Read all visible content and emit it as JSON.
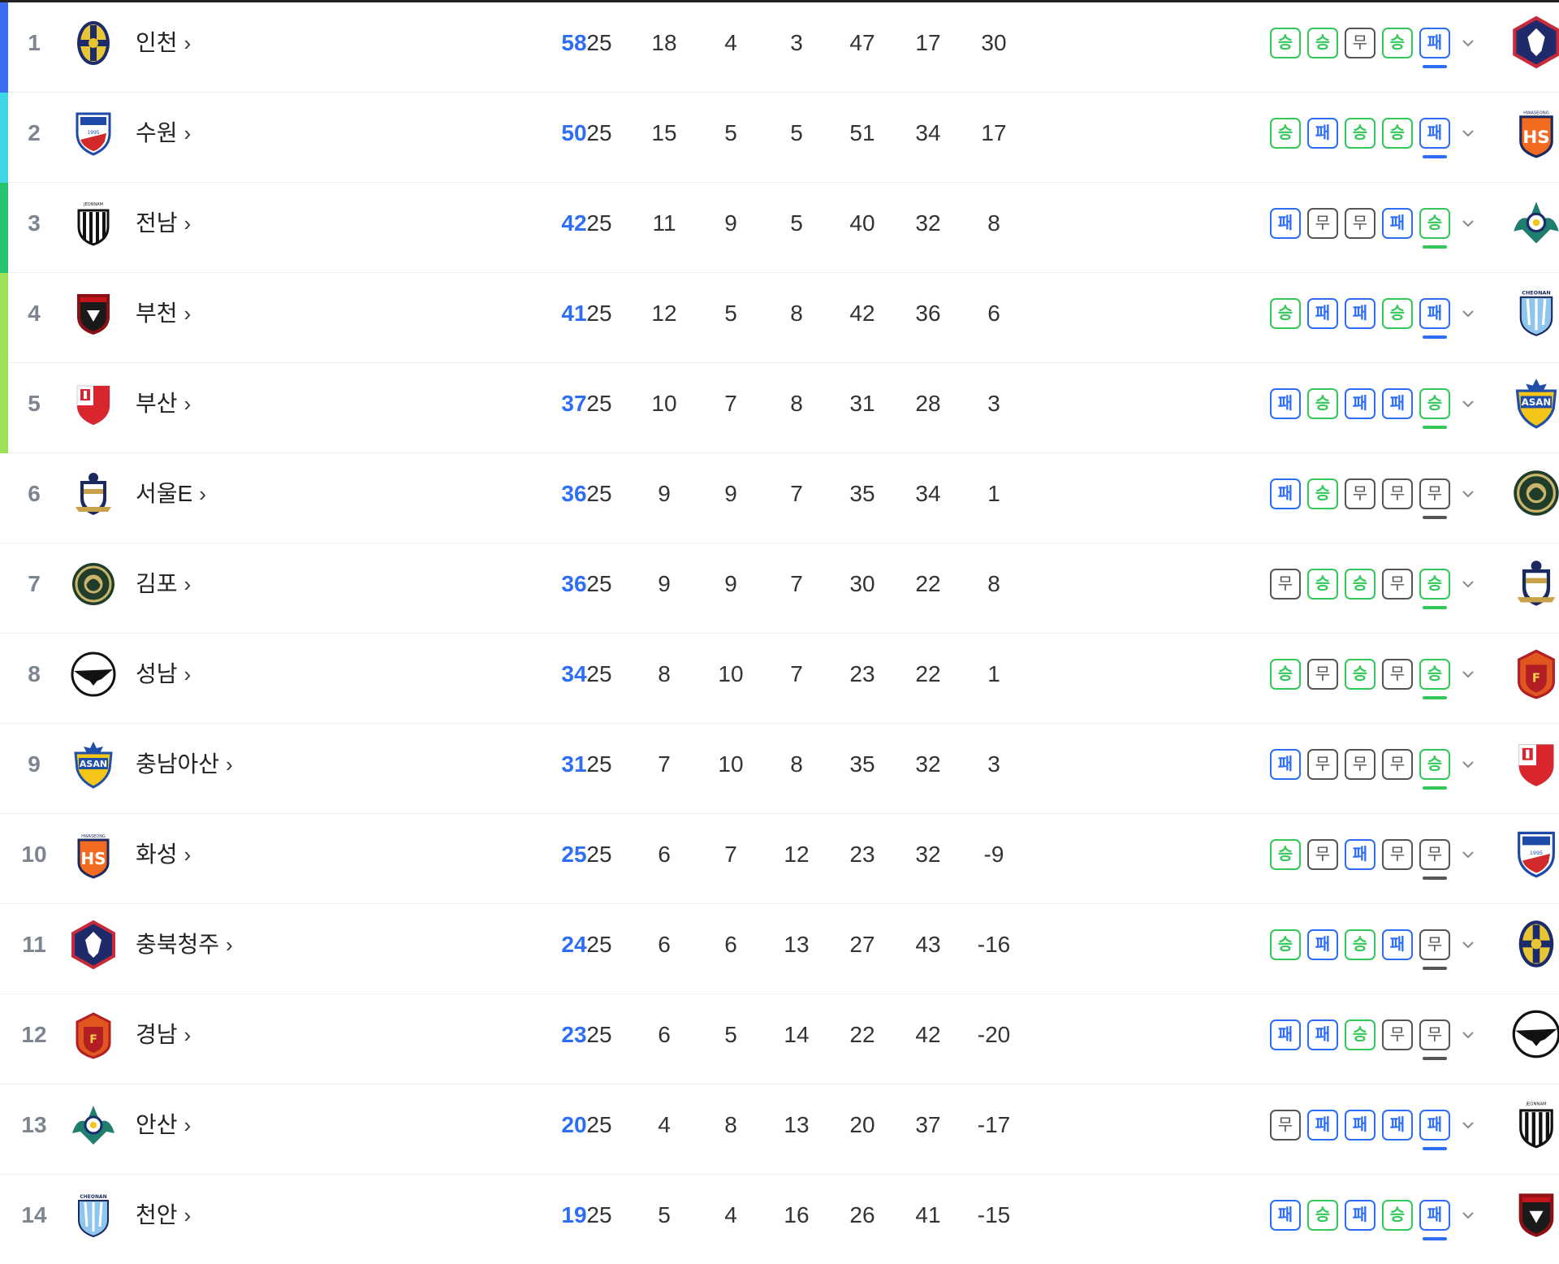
{
  "standings": [
    {
      "rank": "1",
      "team": "인천",
      "logo": "incheon-crest-icon",
      "band": "#3a6df0",
      "pts": "58",
      "mp": "25",
      "w": "18",
      "d": "4",
      "l": "3",
      "gf": "47",
      "ga": "17",
      "gd": "30",
      "form": [
        "승",
        "승",
        "무",
        "승",
        "패"
      ],
      "next_opponent": "chungbuk-cheongju-crest-icon"
    },
    {
      "rank": "2",
      "team": "수원",
      "logo": "suwon-crest-icon",
      "band": "#3fd6e6",
      "pts": "50",
      "mp": "25",
      "w": "15",
      "d": "5",
      "l": "5",
      "gf": "51",
      "ga": "34",
      "gd": "17",
      "form": [
        "승",
        "패",
        "승",
        "승",
        "패"
      ],
      "next_opponent": "hwaseong-crest-icon"
    },
    {
      "rank": "3",
      "team": "전남",
      "logo": "jeonnam-crest-icon",
      "band": "#26c270",
      "pts": "42",
      "mp": "25",
      "w": "11",
      "d": "9",
      "l": "5",
      "gf": "40",
      "ga": "32",
      "gd": "8",
      "form": [
        "패",
        "무",
        "무",
        "패",
        "승"
      ],
      "next_opponent": "ansan-crest-icon"
    },
    {
      "rank": "4",
      "team": "부천",
      "logo": "bucheon-crest-icon",
      "band": "#9ee05a",
      "pts": "41",
      "mp": "25",
      "w": "12",
      "d": "5",
      "l": "8",
      "gf": "42",
      "ga": "36",
      "gd": "6",
      "form": [
        "승",
        "패",
        "패",
        "승",
        "패"
      ],
      "next_opponent": "cheonan-crest-icon"
    },
    {
      "rank": "5",
      "team": "부산",
      "logo": "busan-crest-icon",
      "band": "#9ee05a",
      "pts": "37",
      "mp": "25",
      "w": "10",
      "d": "7",
      "l": "8",
      "gf": "31",
      "ga": "28",
      "gd": "3",
      "form": [
        "패",
        "승",
        "패",
        "패",
        "승"
      ],
      "next_opponent": "chungnam-asan-crest-icon"
    },
    {
      "rank": "6",
      "team": "서울E",
      "logo": "seoul-e-crest-icon",
      "band": "",
      "pts": "36",
      "mp": "25",
      "w": "9",
      "d": "9",
      "l": "7",
      "gf": "35",
      "ga": "34",
      "gd": "1",
      "form": [
        "패",
        "승",
        "무",
        "무",
        "무"
      ],
      "next_opponent": "gimpo-crest-icon"
    },
    {
      "rank": "7",
      "team": "김포",
      "logo": "gimpo-crest-icon",
      "band": "",
      "pts": "36",
      "mp": "25",
      "w": "9",
      "d": "9",
      "l": "7",
      "gf": "30",
      "ga": "22",
      "gd": "8",
      "form": [
        "무",
        "승",
        "승",
        "무",
        "승"
      ],
      "next_opponent": "seoul-e-crest-icon"
    },
    {
      "rank": "8",
      "team": "성남",
      "logo": "seongnam-crest-icon",
      "band": "",
      "pts": "34",
      "mp": "25",
      "w": "8",
      "d": "10",
      "l": "7",
      "gf": "23",
      "ga": "22",
      "gd": "1",
      "form": [
        "승",
        "무",
        "승",
        "무",
        "승"
      ],
      "next_opponent": "gyeongnam-crest-icon"
    },
    {
      "rank": "9",
      "team": "충남아산",
      "logo": "chungnam-asan-crest-icon",
      "band": "",
      "pts": "31",
      "mp": "25",
      "w": "7",
      "d": "10",
      "l": "8",
      "gf": "35",
      "ga": "32",
      "gd": "3",
      "form": [
        "패",
        "무",
        "무",
        "무",
        "승"
      ],
      "next_opponent": "busan-crest-icon"
    },
    {
      "rank": "10",
      "team": "화성",
      "logo": "hwaseong-crest-icon",
      "band": "",
      "pts": "25",
      "mp": "25",
      "w": "6",
      "d": "7",
      "l": "12",
      "gf": "23",
      "ga": "32",
      "gd": "-9",
      "form": [
        "승",
        "무",
        "패",
        "무",
        "무"
      ],
      "next_opponent": "suwon-crest-icon"
    },
    {
      "rank": "11",
      "team": "충북청주",
      "logo": "chungbuk-cheongju-crest-icon",
      "band": "",
      "pts": "24",
      "mp": "25",
      "w": "6",
      "d": "6",
      "l": "13",
      "gf": "27",
      "ga": "43",
      "gd": "-16",
      "form": [
        "승",
        "패",
        "승",
        "패",
        "무"
      ],
      "next_opponent": "incheon-crest-icon"
    },
    {
      "rank": "12",
      "team": "경남",
      "logo": "gyeongnam-crest-icon",
      "band": "",
      "pts": "23",
      "mp": "25",
      "w": "6",
      "d": "5",
      "l": "14",
      "gf": "22",
      "ga": "42",
      "gd": "-20",
      "form": [
        "패",
        "패",
        "승",
        "무",
        "무"
      ],
      "next_opponent": "seongnam-crest-icon"
    },
    {
      "rank": "13",
      "team": "안산",
      "logo": "ansan-crest-icon",
      "band": "",
      "pts": "20",
      "mp": "25",
      "w": "4",
      "d": "8",
      "l": "13",
      "gf": "20",
      "ga": "37",
      "gd": "-17",
      "form": [
        "무",
        "패",
        "패",
        "패",
        "패"
      ],
      "next_opponent": "jeonnam-crest-icon"
    },
    {
      "rank": "14",
      "team": "천안",
      "logo": "cheonan-crest-icon",
      "band": "",
      "pts": "19",
      "mp": "25",
      "w": "5",
      "d": "4",
      "l": "16",
      "gf": "26",
      "ga": "41",
      "gd": "-15",
      "form": [
        "패",
        "승",
        "패",
        "승",
        "패"
      ],
      "next_opponent": "bucheon-crest-icon"
    }
  ],
  "form_colors": {
    "승": "#34c759",
    "패": "#2e6ef5",
    "무": "#555555"
  },
  "points_color": "#2e6ef5"
}
